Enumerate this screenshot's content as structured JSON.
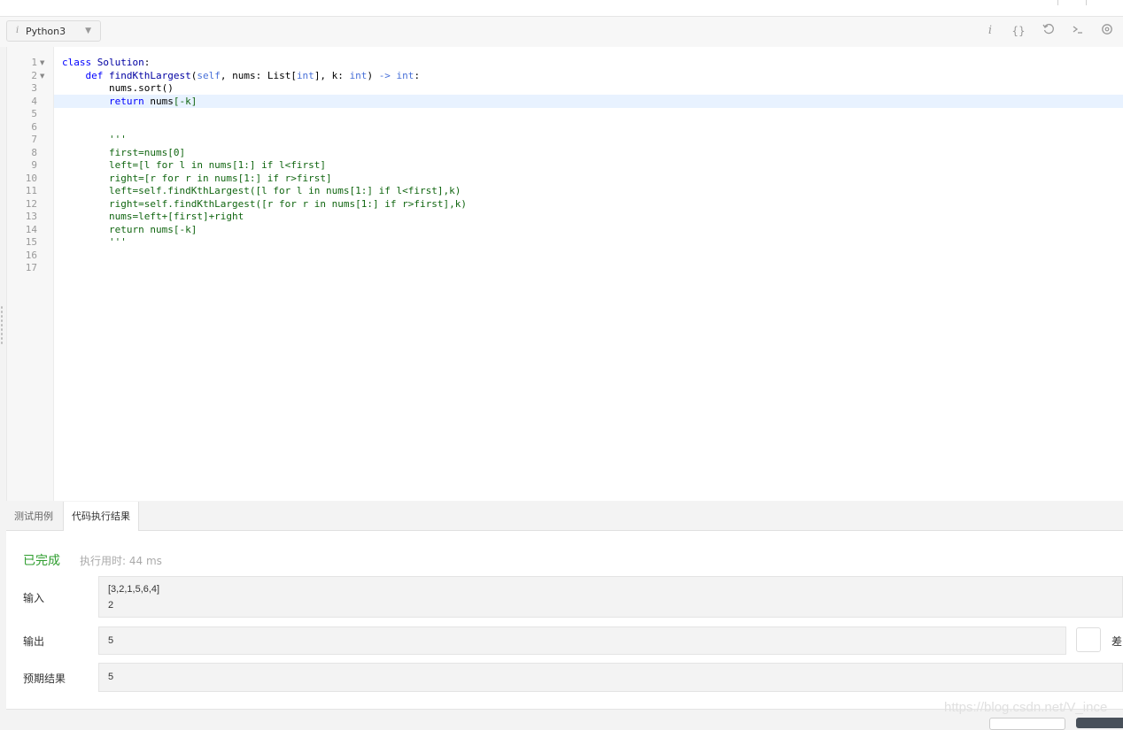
{
  "toolbar": {
    "language": "Python3",
    "info_glyph": "i",
    "icons": [
      "info-icon",
      "braces-icon",
      "reset-icon",
      "console-icon",
      "settings-icon"
    ]
  },
  "editor": {
    "active_line": 4,
    "line_numbers": [
      "1",
      "2",
      "3",
      "4",
      "5",
      "6",
      "7",
      "8",
      "9",
      "10",
      "11",
      "12",
      "13",
      "14",
      "15",
      "16",
      "17"
    ],
    "lines": [
      "class Solution:",
      "    def findKthLargest(self, nums: List[int], k: int) -> int:",
      "        nums.sort()",
      "        return nums[-k]",
      "",
      "",
      "        '''",
      "        first=nums[0]",
      "        left=[l for l in nums[1:] if l<first]",
      "        right=[r for r in nums[1:] if r>first]",
      "        left=self.findKthLargest([l for l in nums[1:] if l<first],k)",
      "        right=self.findKthLargest([r for r in nums[1:] if r>first],k)",
      "        nums=left+[first]+right",
      "        return nums[-k]",
      "        '''",
      "",
      ""
    ]
  },
  "tabs": {
    "test_cases": "测试用例",
    "result": "代码执行结果"
  },
  "result": {
    "status": "已完成",
    "runtime": "执行用时: 44 ms",
    "input_label": "输入",
    "input_line1": "[3,2,1,5,6,4]",
    "input_line2": "2",
    "output_label": "输出",
    "output_value": "5",
    "expected_label": "预期结果",
    "expected_value": "5",
    "diff_label": "差"
  },
  "watermark": "https://blog.csdn.net/V_ince",
  "colors": {
    "success": "#2e9d2e",
    "keyword": "#0000ff",
    "active_line": "#e8f2ff"
  }
}
